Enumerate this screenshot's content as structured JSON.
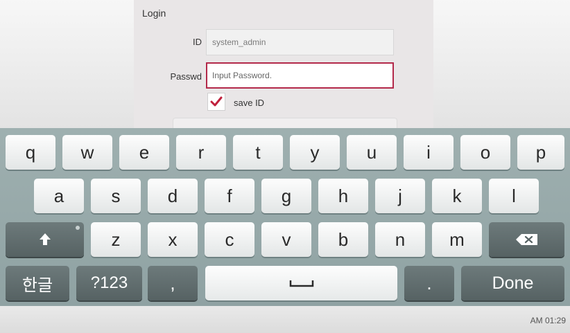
{
  "login": {
    "title": "Login",
    "id_label": "ID",
    "id_value": "system_admin",
    "password_label": "Passwd",
    "password_placeholder": "Input Password.",
    "save_id_label": "save ID",
    "save_id_checked": true
  },
  "keyboard": {
    "row1": [
      "q",
      "w",
      "e",
      "r",
      "t",
      "y",
      "u",
      "i",
      "o",
      "p"
    ],
    "row2": [
      "a",
      "s",
      "d",
      "f",
      "g",
      "h",
      "j",
      "k",
      "l"
    ],
    "row3": [
      "z",
      "x",
      "c",
      "v",
      "b",
      "n",
      "m"
    ],
    "lang_label": "한글",
    "symbols_label": "?123",
    "comma_label": ",",
    "period_label": ".",
    "done_label": "Done"
  },
  "status": {
    "clock": "AM 01:29"
  },
  "colors": {
    "focus_border": "#b3294a",
    "check_mark": "#c0203c"
  }
}
